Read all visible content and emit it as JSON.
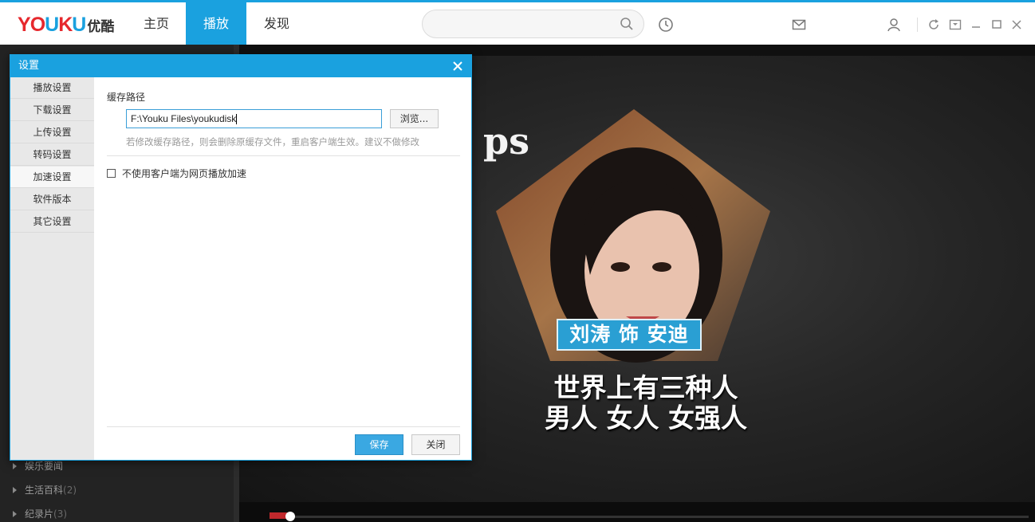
{
  "app": {
    "brand": "YOUKU",
    "brand_cn": "优酷"
  },
  "nav": {
    "tabs": [
      {
        "label": "主页"
      },
      {
        "label": "播放"
      },
      {
        "label": "发现"
      }
    ],
    "active_index": 1
  },
  "search": {
    "placeholder": ""
  },
  "sidebar": {
    "categories": [
      {
        "label": "娱乐要闻",
        "count": ""
      },
      {
        "label": "生活百科",
        "count": "(2)"
      },
      {
        "label": "纪录片",
        "count": "(3)"
      }
    ]
  },
  "video": {
    "overlay_text": "ps",
    "caption_tag": "刘涛 饰 安迪",
    "subtitle_line1": "世界上有三种人",
    "subtitle_line2": "男人 女人 女强人"
  },
  "dialog": {
    "title": "设置",
    "menu": [
      {
        "label": "播放设置"
      },
      {
        "label": "下载设置"
      },
      {
        "label": "上传设置"
      },
      {
        "label": "转码设置"
      },
      {
        "label": "加速设置"
      },
      {
        "label": "软件版本"
      },
      {
        "label": "其它设置"
      }
    ],
    "active_menu_index": 4,
    "cache_path_label": "缓存路径",
    "cache_path_value": "F:\\Youku Files\\youkudisk",
    "browse_label": "浏览...",
    "hint": "若修改缓存路径，则会删除原缓存文件，重启客户端生效。建议不做修改",
    "checkbox_label": "不使用客户端为网页播放加速",
    "checkbox_checked": false,
    "save_label": "保存",
    "close_label": "关闭"
  },
  "colors": {
    "accent": "#1aa1df",
    "brand_red": "#e6282d",
    "save_button": "#3aa8e2"
  }
}
